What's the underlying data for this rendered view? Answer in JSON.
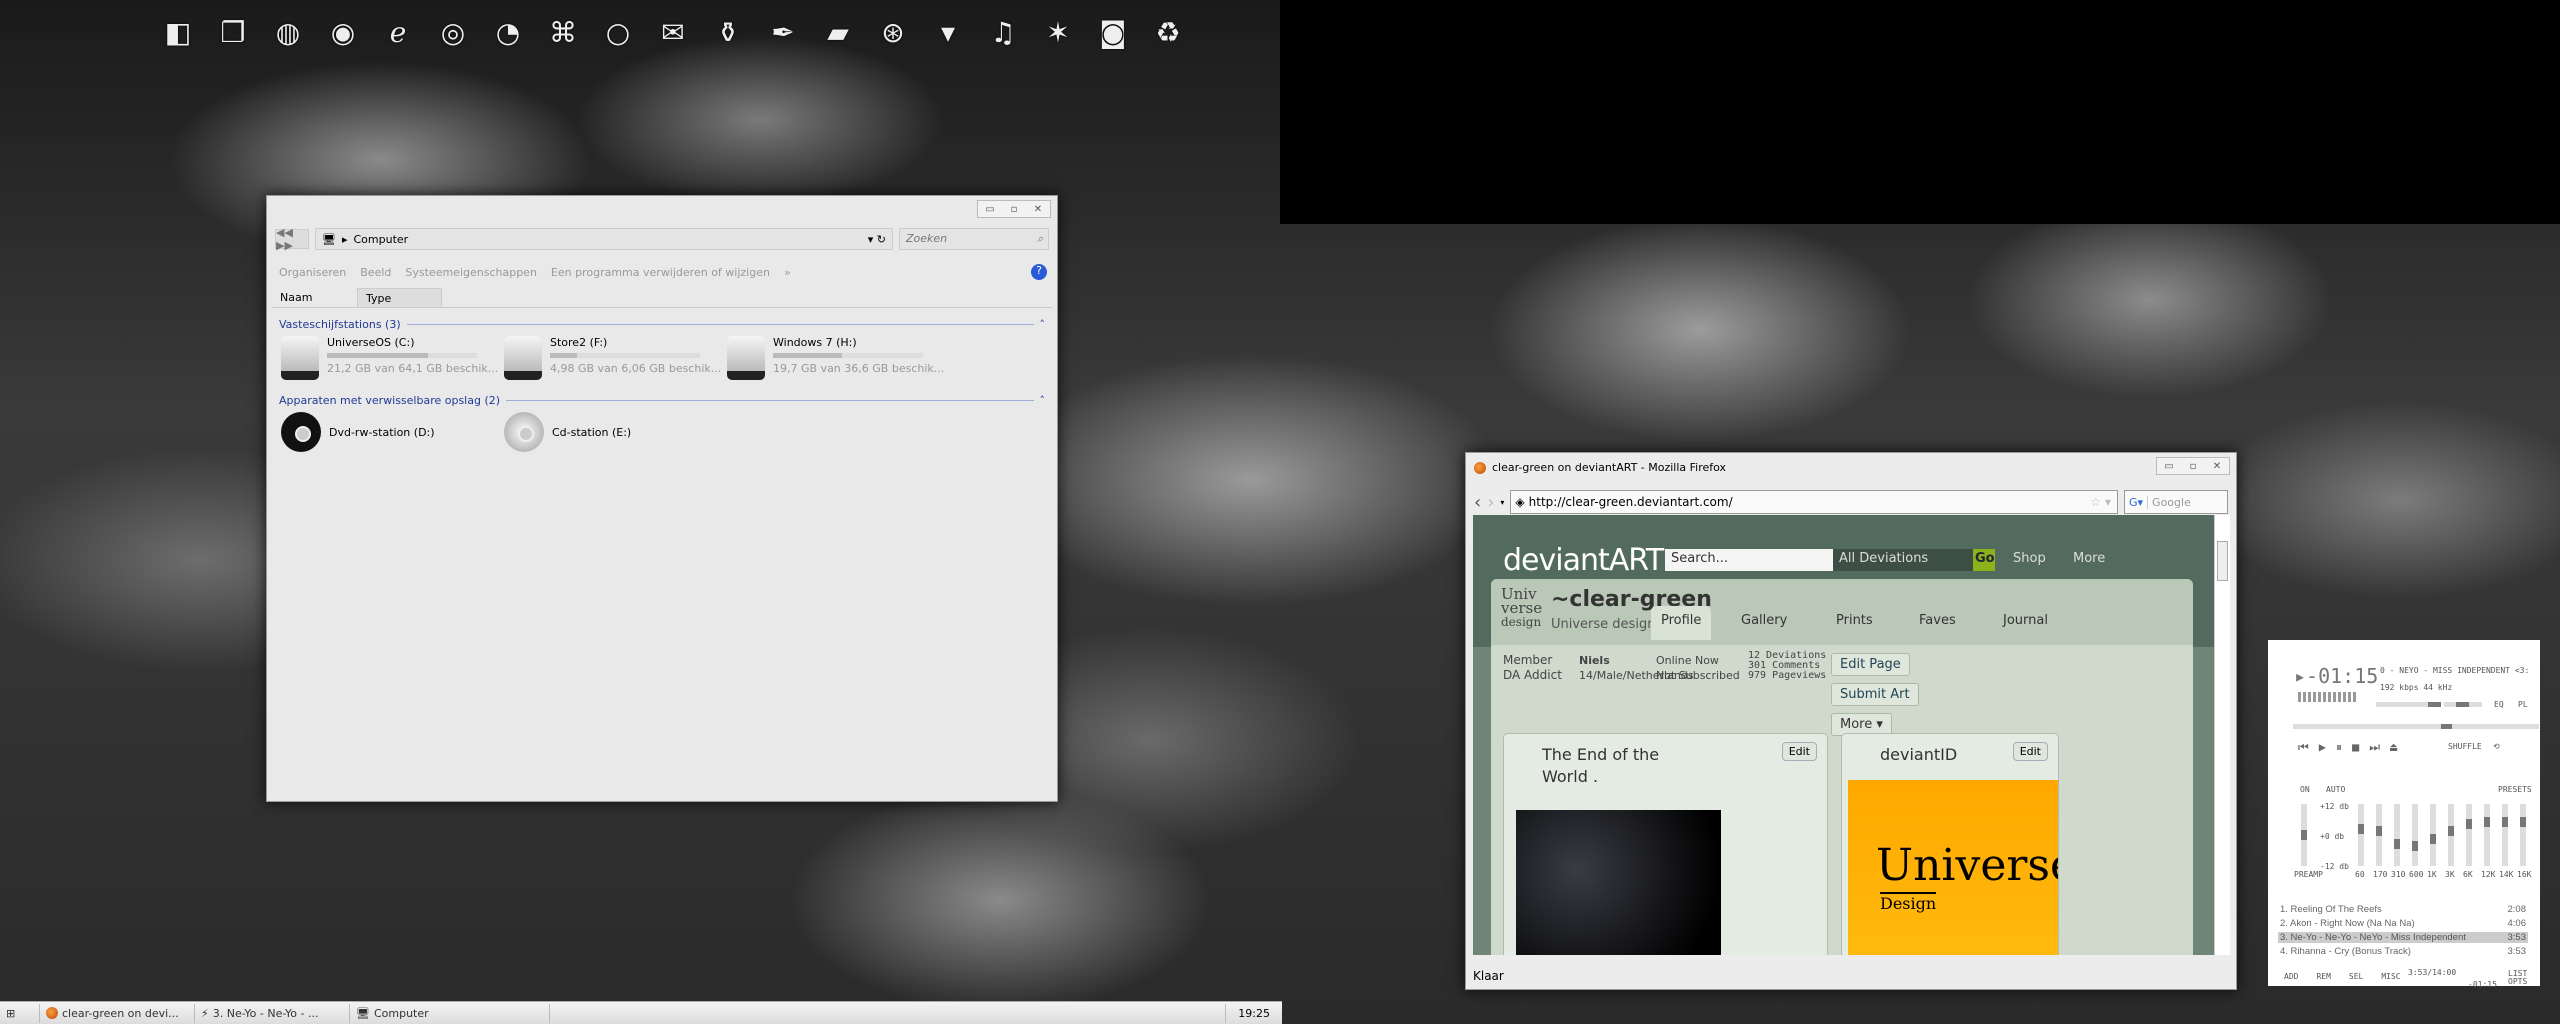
{
  "dock": {
    "icons": [
      "window-icon",
      "stack-icon",
      "activity-monitor-icon",
      "firefox-icon",
      "internet-explorer-icon",
      "media-player-icon",
      "paint-icon",
      "network-icon",
      "circle-icon",
      "mail-icon",
      "pot-icon",
      "feather-icon",
      "folder-icon",
      "safari-icon",
      "download-icon",
      "music-icon",
      "burst-icon",
      "camera-icon",
      "trash-icon"
    ]
  },
  "explorer": {
    "path": "Computer",
    "search_placeholder": "Zoeken",
    "toolbar": [
      "Organiseren",
      "Beeld",
      "Systeemeigenschappen",
      "Een programma verwijderen of wijzigen",
      "»"
    ],
    "columns": [
      "Naam",
      "Type"
    ],
    "groups": [
      {
        "title": "Vasteschijfstations (3)",
        "items": [
          {
            "name": "UniverseOS (C:)",
            "free": "21,2 GB van 64,1 GB beschik...",
            "used_fraction": 0.67
          },
          {
            "name": "Store2 (F:)",
            "free": "4,98 GB van 6,06 GB beschik...",
            "used_fraction": 0.18
          },
          {
            "name": "Windows 7 (H:)",
            "free": "19,7 GB van 36,6 GB beschik...",
            "used_fraction": 0.46
          }
        ]
      },
      {
        "title": "Apparaten met verwisselbare opslag (2)",
        "items": [
          {
            "name": "Dvd-rw-station (D:)"
          },
          {
            "name": "Cd-station (E:)"
          }
        ]
      }
    ]
  },
  "firefox": {
    "title": "clear-green on deviantART - Mozilla Firefox",
    "url": "http://clear-green.deviantart.com/",
    "search_placeholder": "Google",
    "status": "Klaar",
    "page": {
      "logo": "deviantART",
      "search_placeholder": "Search...",
      "scope": "All Deviations",
      "go": "Go",
      "shop": "Shop",
      "more": "More",
      "username": "~clear-green",
      "tagline": "Universe design",
      "avatar_text": [
        "Univ",
        "verse",
        "design"
      ],
      "tabs": [
        "Profile",
        "Gallery",
        "Prints",
        "Faves",
        "Journal"
      ],
      "member": "Member",
      "member_type": "DA Addict",
      "name": "Niels",
      "details": "14/Male/Netherlands",
      "online": "Online Now",
      "subscribed": "Not Subscribed",
      "stats": [
        "12 Deviations",
        "301 Comments",
        "979 Pageviews"
      ],
      "buttons": [
        "Edit Page",
        "Submit Art",
        "More ▾"
      ],
      "cards": [
        {
          "title": "The End of the World .",
          "edit": "Edit"
        },
        {
          "title": "deviantID",
          "edit": "Edit",
          "image_text": "Universe",
          "image_sub": "Design"
        }
      ]
    }
  },
  "winamp": {
    "time": "▸-01:15",
    "track": "0 - NEYO - MISS INDEPENDENT <3:",
    "bitrate": "192 kbps",
    "khz": "44 kHz",
    "eq_toggle": "EQ",
    "pl_toggle": "PL",
    "shuffle": "SHUFFLE",
    "eq": {
      "on": "ON",
      "auto": "AUTO",
      "presets": "PRESETS",
      "db": [
        "+12 db",
        "+0 db",
        "-12 db"
      ],
      "preamp_label": "PREAMP",
      "preamp": 0,
      "bands": [
        {
          "label": "60",
          "value": 3
        },
        {
          "label": "170",
          "value": 2
        },
        {
          "label": "310",
          "value": -4
        },
        {
          "label": "600",
          "value": -5
        },
        {
          "label": "1K",
          "value": -2
        },
        {
          "label": "3K",
          "value": 2
        },
        {
          "label": "6K",
          "value": 5
        },
        {
          "label": "12K",
          "value": 6
        },
        {
          "label": "14K",
          "value": 6
        },
        {
          "label": "16K",
          "value": 6
        }
      ]
    },
    "seek_fraction": 0.63,
    "playlist": [
      {
        "title": "1. Reeling Of The Reefs",
        "time": "2:08"
      },
      {
        "title": "2. Akon - Right Now (Na Na Na)",
        "time": "4:06"
      },
      {
        "title": "3. Ne-Yo - Ne-Yo - NeYo - Miss Independent",
        "time": "3:53",
        "selected": true
      },
      {
        "title": "4. Rihanna - Cry (Bonus Track)",
        "time": "3:53"
      }
    ],
    "pl_buttons": [
      "ADD",
      "REM",
      "SEL",
      "MISC"
    ],
    "total": "3:53/14:00",
    "remaining": "-01:15",
    "list_opts": "LIST OPTS"
  },
  "taskbar": {
    "items": [
      "clear-green on devi...",
      "3. Ne-Yo - Ne-Yo - ...",
      "Computer"
    ],
    "clock": "19:25"
  }
}
